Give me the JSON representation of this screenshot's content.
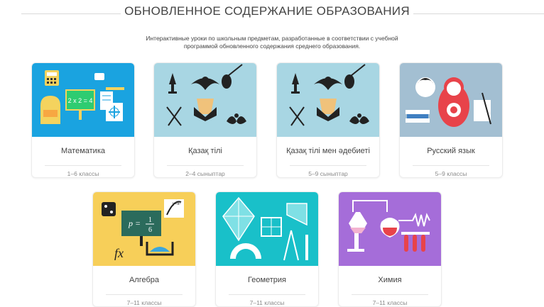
{
  "header": {
    "title": "ОБНОВЛЕННОЕ СОДЕРЖАНИЕ ОБРАЗОВАНИЯ"
  },
  "subtitle": {
    "line1": "Интерактивные уроки по школьным предметам, разработанные в соответствии с учебной",
    "line2": "программой обновленного содержания среднего образования."
  },
  "courses": [
    {
      "name": "Математика",
      "grades": "1–6 классы",
      "color": "#1aa3e0",
      "icon": "math-supplies-icon"
    },
    {
      "name": "Қазақ тілі",
      "grades": "2–4 сыныптар",
      "color": "#a8d6e3",
      "icon": "kazakh-ornament-icon"
    },
    {
      "name": "Қазақ тілі мен әдебиеті",
      "grades": "5–9 сыныптар",
      "color": "#a8d6e3",
      "icon": "kazakh-ornament-icon"
    },
    {
      "name": "Русский язык",
      "grades": "5–9 классы",
      "color": "#a3bfd2",
      "icon": "matryoshka-icon"
    },
    {
      "name": "Алгебра",
      "grades": "7–11 классы",
      "color": "#f7cf59",
      "icon": "algebra-icon"
    },
    {
      "name": "Геометрия",
      "grades": "7–11 классы",
      "color": "#19c0c9",
      "icon": "geometry-icon"
    },
    {
      "name": "Химия",
      "grades": "7–11 классы",
      "color": "#a56dd9",
      "icon": "chemistry-icon"
    }
  ],
  "algebra_formula": {
    "lhs": "p =",
    "num": "1",
    "den": "6",
    "fx": "fx",
    "eq": "y=x²"
  },
  "math_board": "2 x 2 = 4"
}
